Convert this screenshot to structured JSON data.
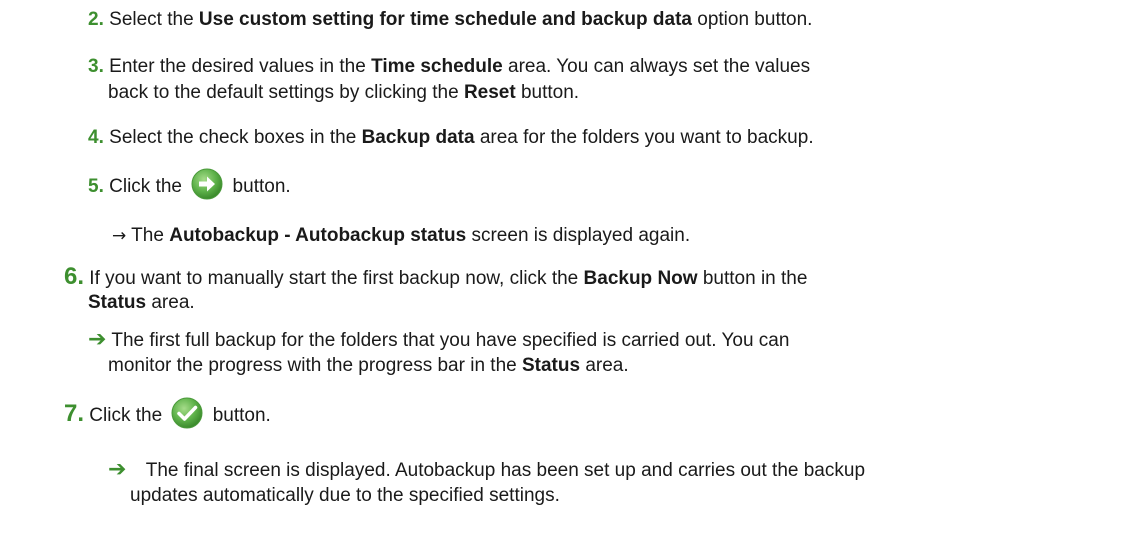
{
  "s2": {
    "num": "2.",
    "t1": "Select the ",
    "b1": "Use custom setting for time schedule and backup data",
    "t2": " option button."
  },
  "s3": {
    "num": "3.",
    "t1": "Enter the desired values in the ",
    "b1": "Time schedule",
    "t2": " area. You can always set the values",
    "l2t1": "back to the default settings by clicking the ",
    "l2b1": "Reset",
    "l2t2": " button."
  },
  "s4": {
    "num": "4.",
    "t1": "Select the check boxes in the ",
    "b1": "Backup data",
    "t2": " area for the folders you want to backup."
  },
  "s5": {
    "num": "5.",
    "t1": "Click the ",
    "t2": " button.",
    "icon": "next-arrow-icon",
    "r_arrow": "→",
    "r_t1": " The ",
    "r_b1": "Autobackup - Autobackup status",
    "r_t2": " screen is displayed again."
  },
  "s6": {
    "num": "6.",
    "t1": "If you want to manually start the first backup now, click the ",
    "b1": "Backup Now",
    "t2": " button in the",
    "l2b1": "Status",
    "l2t1": " area.",
    "r_arrow": "➔",
    "r_t1": "The first full backup for the folders that you have specified is carried out. You can",
    "r_l2t1": "monitor the progress with the progress bar in the ",
    "r_l2b1": "Status",
    "r_l2t2": " area."
  },
  "s7": {
    "num": "7.",
    "t1": "Click the ",
    "t2": " button.",
    "icon": "checkmark-icon",
    "r_arrow": "➔",
    "r_t1": "The final screen is displayed. Autobackup has been set up and carries out the backup",
    "r_l2t1": "updates automatically due to the specified settings."
  }
}
